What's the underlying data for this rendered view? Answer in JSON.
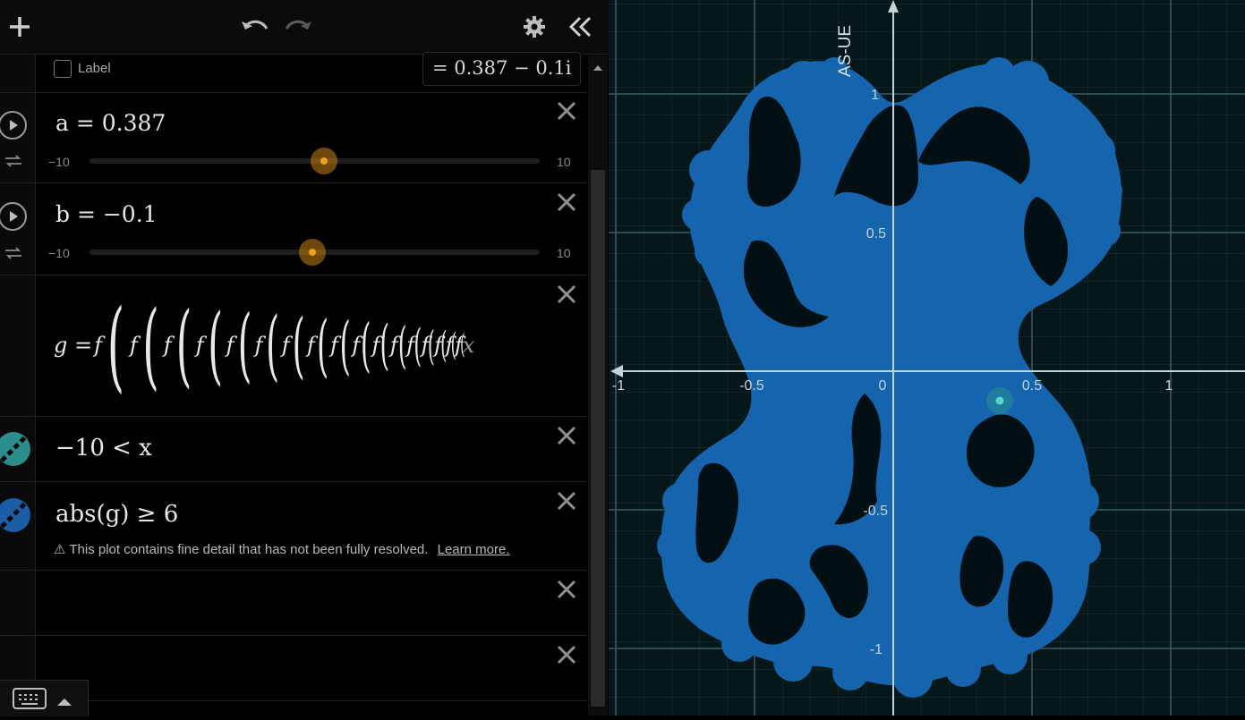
{
  "colors": {
    "accent": "#f0a020",
    "plot_fill": "#1465ad",
    "teal": "#2a8e8c",
    "blue": "#1a5ea8"
  },
  "toolbar": {
    "add_icon": "plus-icon",
    "undo_icon": "undo-icon",
    "redo_icon": "redo-icon",
    "settings_icon": "gear-icon",
    "collapse_icon": "double-chevron-left-icon"
  },
  "point_row": {
    "label_text": "Label",
    "value": "= 0.387 − 0.1i"
  },
  "slider_a": {
    "expr": "a = 0.387",
    "min": "−10",
    "max": "10",
    "value": 0.387
  },
  "slider_b": {
    "expr": "b = −0.1",
    "min": "−10",
    "max": "10",
    "value": -0.1
  },
  "expr_g": {
    "lhs": "g = ",
    "fn": "f",
    "arg": "x"
  },
  "expr_ineq1": {
    "text": "−10 < x"
  },
  "expr_ineq2": {
    "text": "abs(g) ≥ 6",
    "warning": "This plot contains fine detail that has not been fully resolved.",
    "learn_more": "Learn more."
  },
  "graph": {
    "x_ticks": [
      "-1",
      "-0.5",
      "0",
      "0.5",
      "1"
    ],
    "y_ticks": [
      "1",
      "0.5",
      "-0.5",
      "-1"
    ],
    "watermark": "AS-UE"
  }
}
